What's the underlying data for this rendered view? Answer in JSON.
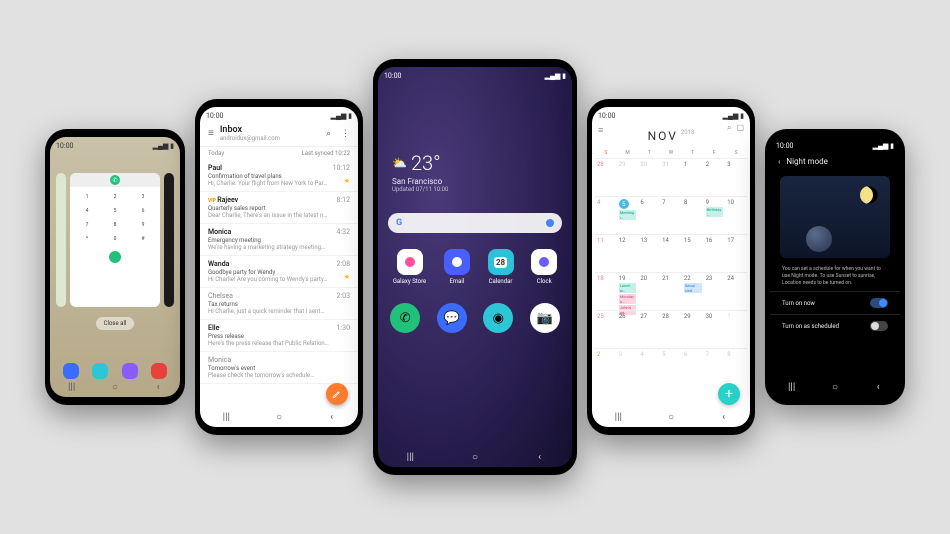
{
  "statusbar_time": "10:00",
  "phone1": {
    "clear_all": "Close all",
    "keys": [
      "1",
      "2",
      "3",
      "4",
      "5",
      "6",
      "7",
      "8",
      "9",
      "*",
      "0",
      "#"
    ],
    "dock_colors": [
      "#3b6cff",
      "#2dc6d6",
      "#8a5cff",
      "#e8413b"
    ]
  },
  "phone2": {
    "title": "Inbox",
    "account": "androidux@gmail.com",
    "section": "Today",
    "synced": "Last synced 10:22",
    "mails": [
      {
        "from": "Paul",
        "time": "10:12",
        "subj": "Confirmation of travel plans",
        "prev": "Hi, Charlie. Your flight from New York to Par…",
        "star": true,
        "read": false
      },
      {
        "from": "Rajeev",
        "time": "8:12",
        "subj": "Quarterly sales report",
        "prev": "Dear Charlie, There's an issue in the latest n…",
        "vip": true,
        "read": false
      },
      {
        "from": "Monica",
        "time": "4:32",
        "subj": "Emergency meeting",
        "prev": "We're having a marketing strategy meeting…",
        "read": false
      },
      {
        "from": "Wanda",
        "time": "2:08",
        "subj": "Goodbye party for Wendy",
        "prev": "Hi Charlie! Are you coming to Wendy's party…",
        "star": true,
        "read": false
      },
      {
        "from": "Chelsea",
        "time": "2:03",
        "subj": "Tax returns",
        "prev": "Hi Charlie, just a quick reminder that I sent…",
        "read": true
      },
      {
        "from": "Elle",
        "time": "1:30",
        "subj": "Press release",
        "prev": "Here's the press release that Public Relation…",
        "read": false
      },
      {
        "from": "Monica",
        "time": "",
        "subj": "Tomorrow's event",
        "prev": "Please check the tomorrow's schedule…",
        "read": true
      }
    ]
  },
  "phone3": {
    "temp": "23°",
    "city": "San Francisco",
    "updated": "Updated 07/11 10:00",
    "apps": [
      {
        "label": "Galaxy Store",
        "bg": "#fff",
        "inner": "#ff4f9a"
      },
      {
        "label": "Email",
        "bg": "#4a5fff",
        "inner": "#fff"
      },
      {
        "label": "Calendar",
        "bg": "#2dc0d8",
        "day": "28"
      },
      {
        "label": "Clock",
        "bg": "#fff",
        "inner": "#6a5cff"
      }
    ],
    "dock": [
      {
        "bg": "#22c17a",
        "name": "phone"
      },
      {
        "bg": "#3b6cff",
        "name": "messages"
      },
      {
        "bg": "#2dc6d6",
        "name": "browser"
      },
      {
        "bg": "#ffffff",
        "name": "camera"
      }
    ]
  },
  "phone4": {
    "month": "NOV",
    "year": "2018",
    "dow": [
      "S",
      "M",
      "T",
      "W",
      "T",
      "F",
      "S"
    ],
    "today": 5,
    "events": {
      "5": [
        {
          "t": "Meeting r…",
          "c": "teal"
        }
      ],
      "9": [
        {
          "t": "Birthday …",
          "c": "teal"
        }
      ],
      "19": [
        {
          "t": "Lunch w…",
          "c": "teal"
        },
        {
          "t": "Monday a…",
          "c": "pink"
        },
        {
          "t": "John's pa…",
          "c": "pink"
        }
      ],
      "21": [
        {
          "t": "",
          "c": "orange"
        },
        {
          "t": "",
          "c": "blue"
        }
      ],
      "22": [
        {
          "t": "Seoul visit",
          "c": "blue"
        }
      ]
    }
  },
  "phone5": {
    "title": "Night mode",
    "desc": "You can set a schedule for when you want to use Night mode. To use Sunset to sunrise, Location needs to be turned on.",
    "opt1": "Turn on now",
    "opt2": "Turn on as scheduled"
  }
}
